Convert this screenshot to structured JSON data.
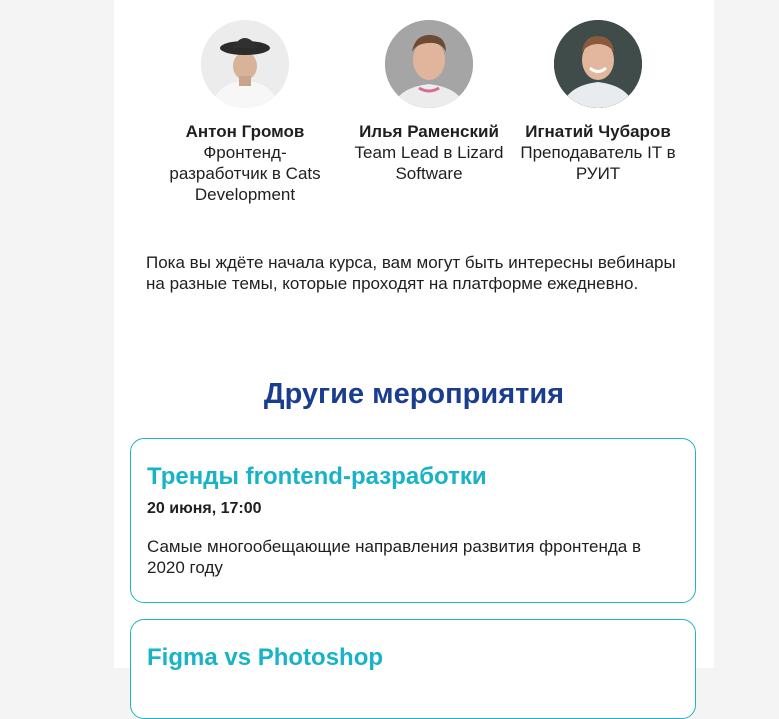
{
  "speakers": [
    {
      "name": "Антон Громов",
      "role": "Фронтенд-разработчик в Cats Development",
      "avatar_icon": "person-in-hat-avatar"
    },
    {
      "name": "Илья Раменский",
      "role": "Team Lead в Lizard Software",
      "avatar_icon": "person-avatar"
    },
    {
      "name": "Игнатий Чубаров",
      "role": "Преподаватель IT в РУИТ",
      "avatar_icon": "person-smiling-avatar"
    }
  ],
  "intro_text": "Пока вы ждёте начала курса, вам могут быть интересны вебинары на разные темы, которые проходят на платформе ежедневно.",
  "section_title": "Другие мероприятия",
  "events": [
    {
      "title": "Тренды frontend-разработки",
      "date": "20 июня, 17:00",
      "description": "Самые многообещающие направления развития фронтенда в 2020 году"
    },
    {
      "title": "Figma vs Photoshop"
    }
  ],
  "colors": {
    "accent": "#19b3c8",
    "heading": "#1b3d8f",
    "border": "#22b4c4",
    "page_bg": "#f4f4f4"
  }
}
